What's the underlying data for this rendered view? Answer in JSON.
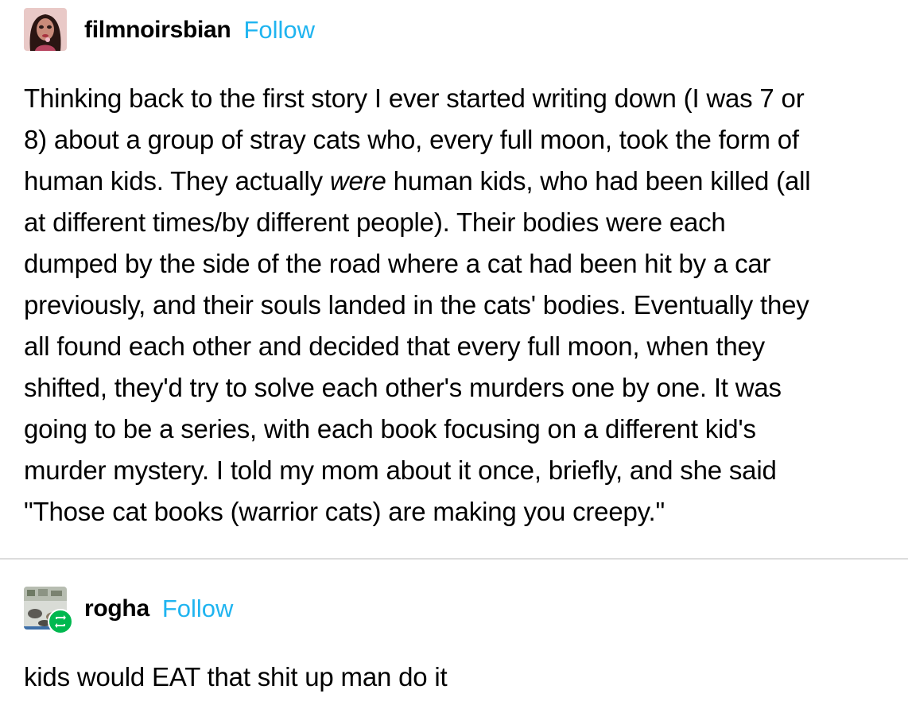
{
  "posts": [
    {
      "username": "filmnoirsbian",
      "follow_label": "Follow",
      "avatar_icon": "avatar-doll-icon",
      "body_lines": [
        {
          "pre": "Thinking back to the first story I ever started writing down (I was 7 or",
          "em": "",
          "post": ""
        },
        {
          "pre": "8) about a group of stray cats who, every full moon, took the form of",
          "em": "",
          "post": ""
        },
        {
          "pre": "human kids. They actually ",
          "em": "were",
          "post": " human kids, who had been killed (all"
        },
        {
          "pre": "at different times/by different people). Their bodies were each",
          "em": "",
          "post": ""
        },
        {
          "pre": "dumped by the side of the road where a cat had been hit by a car",
          "em": "",
          "post": ""
        },
        {
          "pre": "previously, and their souls landed in the cats' bodies. Eventually they",
          "em": "",
          "post": ""
        },
        {
          "pre": "all found each other and decided that every full moon, when they",
          "em": "",
          "post": ""
        },
        {
          "pre": "shifted, they'd try to solve each other's murders one by one. It was",
          "em": "",
          "post": ""
        },
        {
          "pre": "going to be a series, with each book focusing on a different kid's",
          "em": "",
          "post": ""
        },
        {
          "pre": "murder mystery. I told my mom about it once, briefly, and she said",
          "em": "",
          "post": ""
        },
        {
          "pre": "\"Those cat books (warrior cats) are making you creepy.\"",
          "em": "",
          "post": ""
        }
      ]
    },
    {
      "username": "rogha",
      "follow_label": "Follow",
      "avatar_icon": "avatar-cats-photo-icon",
      "reblog_icon": "reblog-icon",
      "body_lines": [
        {
          "pre": "kids would EAT that shit up man do it",
          "em": "",
          "post": ""
        }
      ]
    }
  ],
  "colors": {
    "follow": "#1fb4f0",
    "reblog_badge": "#00b84f",
    "divider": "#dcdcdc"
  }
}
